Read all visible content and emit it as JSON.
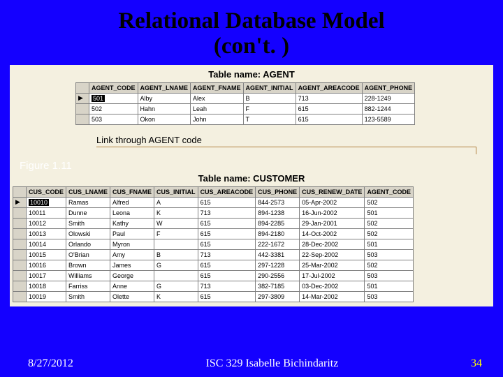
{
  "title_line1": "Relational Database Model",
  "title_line2": "(con't. )",
  "figure_label": "Figure 1.11",
  "link_text": "Link through AGENT code",
  "agent": {
    "caption": "Table name: AGENT",
    "headers": [
      "AGENT_CODE",
      "AGENT_LNAME",
      "AGENT_FNAME",
      "AGENT_INITIAL",
      "AGENT_AREACODE",
      "AGENT_PHONE"
    ],
    "rows": [
      [
        "501",
        "Alby",
        "Alex",
        "B",
        "713",
        "228-1249"
      ],
      [
        "502",
        "Hahn",
        "Leah",
        "F",
        "615",
        "882-1244"
      ],
      [
        "503",
        "Okon",
        "John",
        "T",
        "615",
        "123-5589"
      ]
    ]
  },
  "customer": {
    "caption": "Table name: CUSTOMER",
    "headers": [
      "CUS_CODE",
      "CUS_LNAME",
      "CUS_FNAME",
      "CUS_INITIAL",
      "CUS_AREACODE",
      "CUS_PHONE",
      "CUS_RENEW_DATE",
      "AGENT_CODE"
    ],
    "rows": [
      [
        "10010",
        "Ramas",
        "Alfred",
        "A",
        "615",
        "844-2573",
        "05-Apr-2002",
        "502"
      ],
      [
        "10011",
        "Dunne",
        "Leona",
        "K",
        "713",
        "894-1238",
        "16-Jun-2002",
        "501"
      ],
      [
        "10012",
        "Smith",
        "Kathy",
        "W",
        "615",
        "894-2285",
        "29-Jan-2001",
        "502"
      ],
      [
        "10013",
        "Olowski",
        "Paul",
        "F",
        "615",
        "894-2180",
        "14-Oct-2002",
        "502"
      ],
      [
        "10014",
        "Orlando",
        "Myron",
        "",
        "615",
        "222-1672",
        "28-Dec-2002",
        "501"
      ],
      [
        "10015",
        "O'Brian",
        "Amy",
        "B",
        "713",
        "442-3381",
        "22-Sep-2002",
        "503"
      ],
      [
        "10016",
        "Brown",
        "James",
        "G",
        "615",
        "297-1228",
        "25-Mar-2002",
        "502"
      ],
      [
        "10017",
        "Williams",
        "George",
        "",
        "615",
        "290-2556",
        "17-Jul-2002",
        "503"
      ],
      [
        "10018",
        "Farriss",
        "Anne",
        "G",
        "713",
        "382-7185",
        "03-Dec-2002",
        "501"
      ],
      [
        "10019",
        "Smith",
        "Olette",
        "K",
        "615",
        "297-3809",
        "14-Mar-2002",
        "503"
      ]
    ]
  },
  "footer": {
    "date": "8/27/2012",
    "course": "ISC 329 Isabelle Bichindaritz",
    "page": "34"
  }
}
